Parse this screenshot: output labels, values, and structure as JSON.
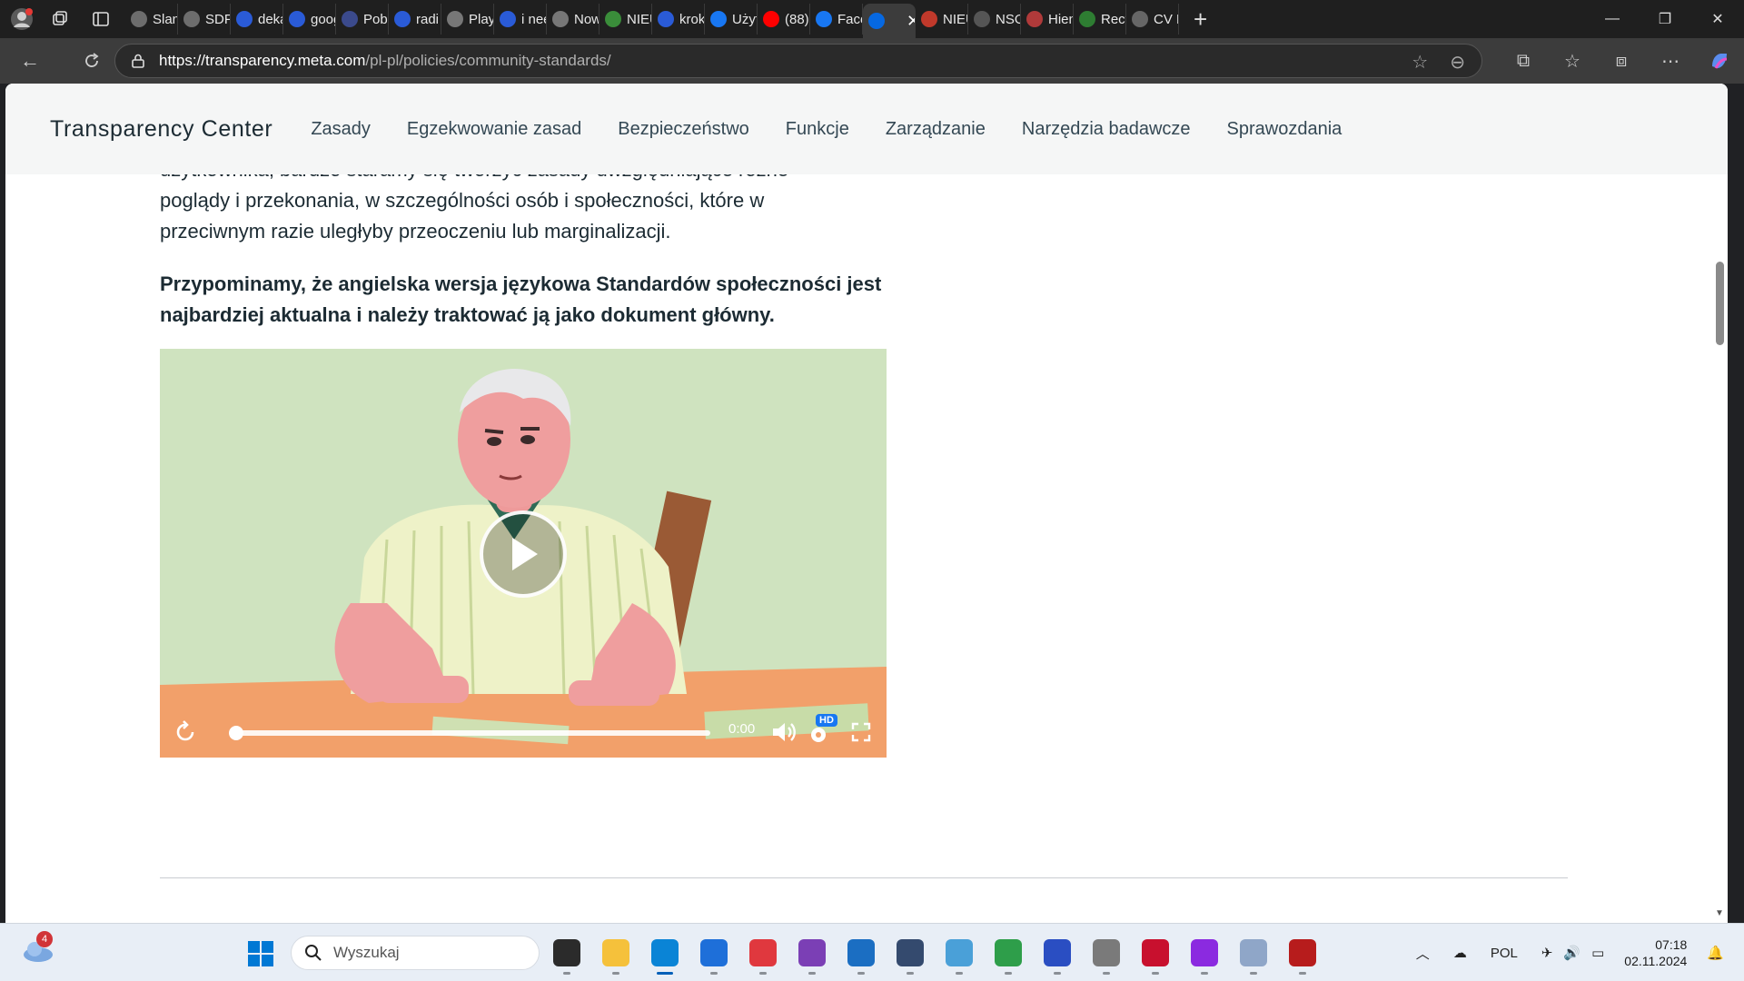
{
  "browser": {
    "tabs": [
      {
        "label": "Slang",
        "fav": "#6d6d6d"
      },
      {
        "label": "SDF |",
        "fav": "#6d6d6d"
      },
      {
        "label": "deka",
        "fav": "#2a5bd7"
      },
      {
        "label": "goog",
        "fav": "#2a5bd7"
      },
      {
        "label": "Pobi",
        "fav": "#3b4a8c"
      },
      {
        "label": "radi",
        "fav": "#2a5bd7"
      },
      {
        "label": "Playe",
        "fav": "#777"
      },
      {
        "label": "i nee",
        "fav": "#2a5bd7"
      },
      {
        "label": "Now",
        "fav": "#777"
      },
      {
        "label": "NIEU",
        "fav": "#3a8d3a"
      },
      {
        "label": "krok",
        "fav": "#2a5bd7"
      },
      {
        "label": "Użyt",
        "fav": "#1877f2"
      },
      {
        "label": "(88)",
        "fav": "#ff0000"
      },
      {
        "label": "Face",
        "fav": "#1877f2"
      },
      {
        "label": "",
        "fav": "#0668e1"
      },
      {
        "label": "NIEU",
        "fav": "#c0392b"
      },
      {
        "label": "NSO",
        "fav": "#555"
      },
      {
        "label": "Hien",
        "fav": "#b03a3a"
      },
      {
        "label": "Recy",
        "fav": "#2e7d32"
      },
      {
        "label": "CV R",
        "fav": "#666"
      }
    ],
    "url_host": "https://transparency.meta.com",
    "url_path": "/pl-pl/policies/community-standards/"
  },
  "site": {
    "brand": "Transparency Center",
    "nav": [
      "Zasady",
      "Egzekwowanie zasad",
      "Bezpieczeństwo",
      "Funkcje",
      "Zarządzanie",
      "Narzędzia badawcze",
      "Sprawozdania"
    ]
  },
  "content": {
    "para_cut_line0": "użytkownika, bardzo staramy się tworzyć zasady uwzględniające różne",
    "para_cut_line1": "poglądy i przekonania, w szczególności osób i społeczności, które w",
    "para_cut_line2": "przeciwnym razie uległyby przeoczeniu lub marginalizacji.",
    "bold_line0": "Przypominamy, że angielska wersja językowa Standardów społeczności jest",
    "bold_line1": "najbardziej aktualna i należy traktować ją jako dokument główny."
  },
  "video": {
    "time": "0:00",
    "quality_badge": "HD",
    "progress": 0
  },
  "taskbar": {
    "search_placeholder": "Wyszukaj",
    "notification_count": "4",
    "language": "POL",
    "time": "07:18",
    "date": "02.11.2024",
    "apps": [
      {
        "name": "task-view",
        "color": "#2b2b2b"
      },
      {
        "name": "file-explorer",
        "color": "#f5c13b"
      },
      {
        "name": "edge",
        "color": "#0a84d6",
        "active": true
      },
      {
        "name": "store",
        "color": "#1e6fd9"
      },
      {
        "name": "app-red",
        "color": "#e0383e"
      },
      {
        "name": "github",
        "color": "#7b3fb5"
      },
      {
        "name": "app-blue-hex",
        "color": "#1b6ec2"
      },
      {
        "name": "app-cube",
        "color": "#344a6e"
      },
      {
        "name": "app-screen",
        "color": "#4aa0d8"
      },
      {
        "name": "app-globe",
        "color": "#2e9e4a"
      },
      {
        "name": "app-save",
        "color": "#2a4ec2"
      },
      {
        "name": "app-drive",
        "color": "#7a7a7a"
      },
      {
        "name": "app-ghost",
        "color": "#c8102e"
      },
      {
        "name": "app-purple",
        "color": "#8b2ae0"
      },
      {
        "name": "app-disk",
        "color": "#8fa6c8"
      },
      {
        "name": "app-d",
        "color": "#b71c1c"
      }
    ]
  }
}
